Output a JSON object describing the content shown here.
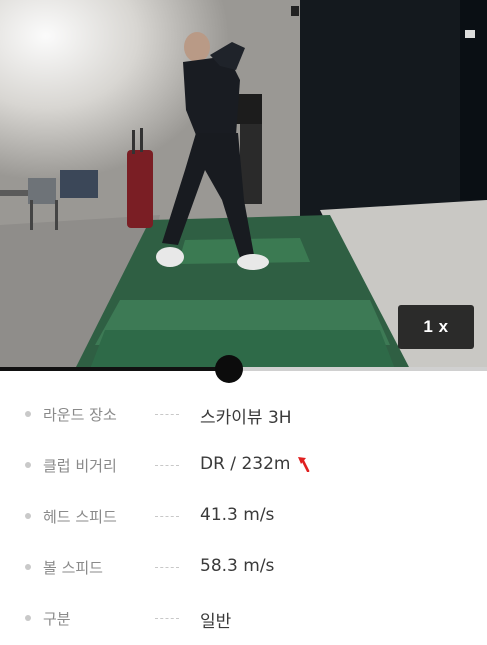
{
  "player": {
    "speed_label": "1 x",
    "progress": 0.47
  },
  "details": [
    {
      "label": "라운드 장소",
      "value": "스카이뷰 3H"
    },
    {
      "label": "클럽 비거리",
      "value": "DR / 232m",
      "icon": "hook-arrow-icon",
      "icon_color": "#e02020"
    },
    {
      "label": "헤드 스피드",
      "value": "41.3 m/s"
    },
    {
      "label": "볼 스피드",
      "value": "58.3 m/s"
    },
    {
      "label": "구분",
      "value": "일반"
    }
  ]
}
